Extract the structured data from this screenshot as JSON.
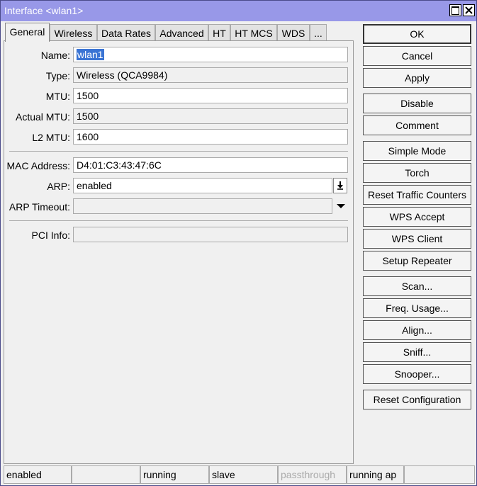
{
  "window": {
    "title": "Interface <wlan1>"
  },
  "tabs": [
    "General",
    "Wireless",
    "Data Rates",
    "Advanced",
    "HT",
    "HT MCS",
    "WDS",
    "..."
  ],
  "form": {
    "name_label": "Name:",
    "name_value": "wlan1",
    "type_label": "Type:",
    "type_value": "Wireless (QCA9984)",
    "mtu_label": "MTU:",
    "mtu_value": "1500",
    "actual_mtu_label": "Actual MTU:",
    "actual_mtu_value": "1500",
    "l2mtu_label": "L2 MTU:",
    "l2mtu_value": "1600",
    "mac_label": "MAC Address:",
    "mac_value": "D4:01:C3:43:47:6C",
    "arp_label": "ARP:",
    "arp_value": "enabled",
    "arp_timeout_label": "ARP Timeout:",
    "arp_timeout_value": "",
    "pci_label": "PCI Info:",
    "pci_value": ""
  },
  "buttons": {
    "ok": "OK",
    "cancel": "Cancel",
    "apply": "Apply",
    "disable": "Disable",
    "comment": "Comment",
    "simple_mode": "Simple Mode",
    "torch": "Torch",
    "reset_traffic": "Reset Traffic Counters",
    "wps_accept": "WPS Accept",
    "wps_client": "WPS Client",
    "setup_repeater": "Setup Repeater",
    "scan": "Scan...",
    "freq_usage": "Freq. Usage...",
    "align": "Align...",
    "sniff": "Sniff...",
    "snooper": "Snooper...",
    "reset_config": "Reset Configuration"
  },
  "status": [
    "enabled",
    "",
    "running",
    "slave",
    "passthrough",
    "running ap",
    ""
  ]
}
